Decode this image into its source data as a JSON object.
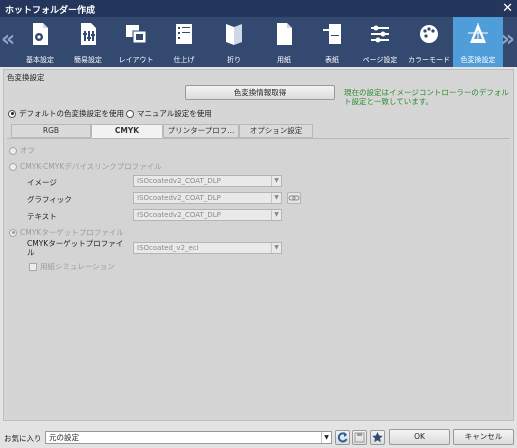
{
  "window": {
    "title": "ホットフォルダー作成",
    "close_glyph": "✕"
  },
  "toolbar": {
    "prev_glyph": "«",
    "next_glyph": "»",
    "items": [
      {
        "label": "基本設定",
        "icon": "basic-settings-icon"
      },
      {
        "label": "簡易設定",
        "icon": "quick-settings-icon"
      },
      {
        "label": "レイアウト",
        "icon": "layout-icon"
      },
      {
        "label": "仕上げ",
        "icon": "finishing-icon"
      },
      {
        "label": "折り",
        "icon": "fold-icon"
      },
      {
        "label": "用紙",
        "icon": "paper-icon"
      },
      {
        "label": "表紙",
        "icon": "cover-icon"
      },
      {
        "label": "ページ設定",
        "icon": "page-settings-icon"
      },
      {
        "label": "カラーモード",
        "icon": "color-mode-icon"
      },
      {
        "label": "色変換設定",
        "icon": "color-conversion-icon",
        "active": true
      }
    ]
  },
  "section": {
    "title": "色変換設定",
    "get_info_button": "色変換情報取得",
    "info_text": "現在の設定はイメージコントローラーのデフォルト設定と一致しています。",
    "radio_default": "デフォルトの色変換設定を使用",
    "radio_manual": "マニュアル設定を使用"
  },
  "tabs": [
    "RGB",
    "CMYK",
    "プリンタープロフ...",
    "オプション設定"
  ],
  "cmyk": {
    "off_label": "オフ",
    "devicelink_label": "CMYK-CMYKデバイスリンクプロファイル",
    "image_label": "イメージ",
    "image_value": "ISOcoatedv2_COAT_DLP",
    "graphic_label": "グラフィック",
    "graphic_value": "ISOcoatedv2_COAT_DLP",
    "text_label": "テキスト",
    "text_value": "ISOcoatedv2_COAT_DLP",
    "target_label": "CMYKターゲットプロファイル",
    "target_field_label_1": "CMYKターゲットプロファイ",
    "target_field_label_2": "ル",
    "target_value": "ISOcoated_v2_eci",
    "paper_sim_label": "用紙シミュレーション",
    "dropdown_glyph": "▼"
  },
  "bottom": {
    "favorites_label": "お気に入り",
    "favorites_value": "元の設定",
    "ok_button": "OK",
    "cancel_button": "キャンセル"
  },
  "colors": {
    "titlebar": "#24365b",
    "toolbar": "#34496f",
    "active_tab": "#4f9dd9",
    "info_text": "#2d8a2d"
  }
}
